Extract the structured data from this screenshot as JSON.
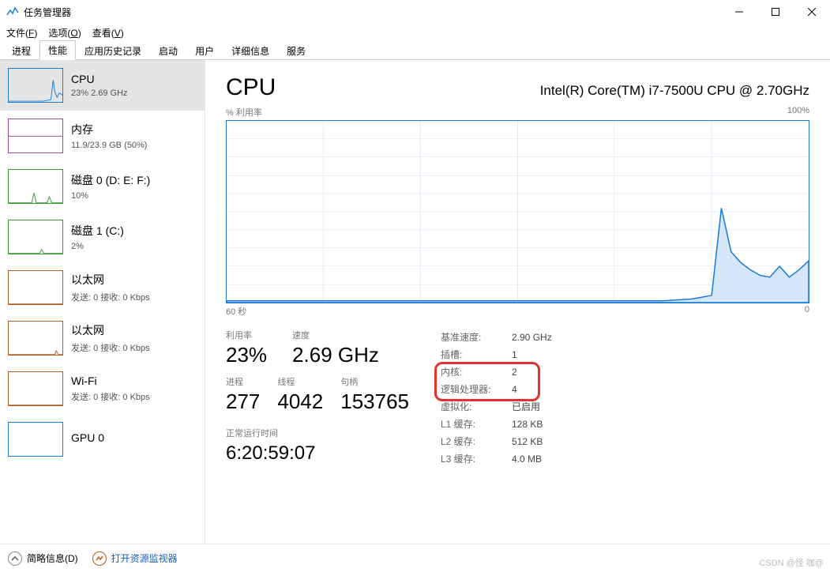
{
  "window": {
    "title": "任务管理器"
  },
  "menu": {
    "file": "文件(",
    "file_u": "F",
    "file_end": ")",
    "options": "选项(",
    "options_u": "O",
    "options_end": ")",
    "view": "查看(",
    "view_u": "V",
    "view_end": ")"
  },
  "tabs": [
    "进程",
    "性能",
    "应用历史记录",
    "启动",
    "用户",
    "详细信息",
    "服务"
  ],
  "active_tab": 1,
  "sidebar": [
    {
      "name": "CPU",
      "detail": "23% 2.69 GHz",
      "kind": "cpu"
    },
    {
      "name": "内存",
      "detail": "11.9/23.9 GB (50%)",
      "kind": "mem"
    },
    {
      "name": "磁盘 0 (D: E: F:)",
      "detail": "10%",
      "kind": "disk"
    },
    {
      "name": "磁盘 1 (C:)",
      "detail": "2%",
      "kind": "disk"
    },
    {
      "name": "以太网",
      "detail": "发送: 0 接收: 0 Kbps",
      "kind": "net"
    },
    {
      "name": "以太网",
      "detail": "发送: 0 接收: 0 Kbps",
      "kind": "net"
    },
    {
      "name": "Wi-Fi",
      "detail": "发送: 0 接收: 0 Kbps",
      "kind": "wifi"
    },
    {
      "name": "GPU 0",
      "detail": "",
      "kind": "cpu"
    }
  ],
  "main": {
    "heading": "CPU",
    "cpu_name": "Intel(R) Core(TM) i7-7500U CPU @ 2.70GHz",
    "chart_top_left": "% 利用率",
    "chart_top_right": "100%",
    "chart_bottom_left": "60 秒",
    "chart_bottom_right": "0",
    "util_label": "利用率",
    "util_value": "23%",
    "speed_label": "速度",
    "speed_value": "2.69 GHz",
    "proc_label": "进程",
    "proc_value": "277",
    "thread_label": "线程",
    "thread_value": "4042",
    "handle_label": "句柄",
    "handle_value": "153765",
    "uptime_label": "正常运行时间",
    "uptime_value": "6:20:59:07",
    "specs": [
      {
        "k": "基准速度:",
        "v": "2.90 GHz"
      },
      {
        "k": "插槽:",
        "v": "1"
      },
      {
        "k": "内核:",
        "v": "2"
      },
      {
        "k": "逻辑处理器:",
        "v": "4"
      },
      {
        "k": "虚拟化:",
        "v": "已启用"
      },
      {
        "k": "L1 缓存:",
        "v": "128 KB"
      },
      {
        "k": "L2 缓存:",
        "v": "512 KB"
      },
      {
        "k": "L3 缓存:",
        "v": "4.0 MB"
      }
    ]
  },
  "chart_data": {
    "type": "area",
    "xlabel": "60 秒",
    "ylabel": "% 利用率",
    "ylim": [
      0,
      100
    ],
    "xlim": [
      60,
      0
    ],
    "x": [
      60,
      55,
      50,
      45,
      40,
      35,
      30,
      25,
      20,
      15,
      12,
      11,
      10,
      9,
      8,
      7,
      6,
      5,
      4,
      3,
      2,
      1,
      0
    ],
    "values": [
      1,
      1,
      1,
      1,
      1,
      1,
      1,
      1,
      1,
      1,
      2,
      3,
      4,
      52,
      28,
      22,
      18,
      15,
      14,
      20,
      14,
      18,
      23
    ]
  },
  "footer": {
    "brief": "简略信息(",
    "brief_u": "D",
    "brief_end": ")",
    "res_mon": "打开资源监视器"
  },
  "watermark": "CSDN @怪 咖@"
}
